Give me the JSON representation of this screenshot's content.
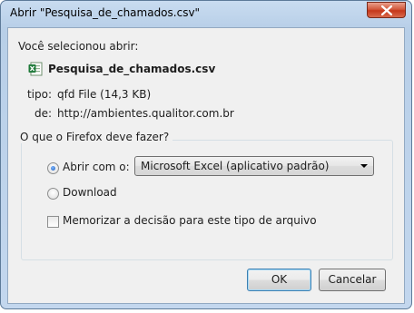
{
  "window": {
    "title": "Abrir \"Pesquisa_de_chamados.csv\""
  },
  "dialog": {
    "selected_label": "Você selecionou abrir:",
    "file_name": "Pesquisa_de_chamados.csv",
    "type_label": "tipo:",
    "type_value": "qfd File (14,3 KB)",
    "from_label": "de:",
    "from_value": "http://ambientes.qualitor.com.br"
  },
  "action_group": {
    "legend": "O que o Firefox deve fazer?",
    "open_with_label": "Abrir com o:",
    "open_with_selected": true,
    "app_selected": "Microsoft Excel (aplicativo padrão)",
    "download_label": "Download",
    "download_selected": false,
    "remember_label": "Memorizar a decisão para este tipo de arquivo",
    "remember_checked": false
  },
  "buttons": {
    "ok": "OK",
    "cancel": "Cancelar"
  },
  "icons": {
    "file": "excel-csv-file-icon",
    "close": "close-icon"
  },
  "colors": {
    "close_button": "#c5371a",
    "title_bar": "#b8cfe8",
    "client_bg": "#f0f0f0"
  }
}
